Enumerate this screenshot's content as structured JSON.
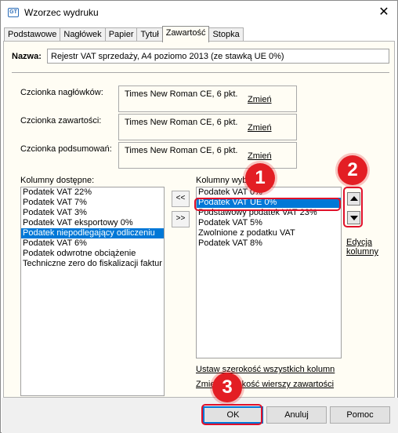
{
  "window": {
    "title": "Wzorzec wydruku",
    "icon": "app-icon",
    "close_label": "✕"
  },
  "tabs": [
    "Podstawowe",
    "Nagłówek",
    "Papier",
    "Tytuł",
    "Zawartość",
    "Stopka"
  ],
  "active_tab": "Zawartość",
  "name": {
    "label": "Nazwa:",
    "value": "Rejestr VAT sprzedaży, A4 poziomo 2013 (ze stawką UE 0%)"
  },
  "fonts": [
    {
      "label": "Czcionka nagłówków:",
      "value": "Times New Roman CE, 6 pkt.",
      "action": "Zmień"
    },
    {
      "label": "Czcionka zawartości:",
      "value": "Times New Roman CE, 6 pkt.",
      "action": "Zmień"
    },
    {
      "label": "Czcionka podsumowań:",
      "value": "Times New Roman CE, 6 pkt.",
      "action": "Zmień"
    }
  ],
  "available": {
    "label": "Kolumny dostępne:",
    "items": [
      "Podatek VAT 22%",
      "Podatek VAT 7%",
      "Podatek VAT 3%",
      "Podatek VAT eksportowy 0%",
      "Podatek niepodlegający odliczeniu",
      "Podatek VAT 6%",
      "Podatek odwrotne obciążenie",
      "Techniczne zero do fiskalizacji faktur r"
    ],
    "selected_index": 4
  },
  "move_buttons": {
    "left": "<<",
    "right": ">>"
  },
  "chosen": {
    "label": "Kolumny wybrane",
    "items": [
      "Podatek VAT 0%",
      "Podatek VAT UE 0%",
      "Podstawowy podatek VAT 23%",
      "Podatek VAT 5%",
      "Zwolnione z podatku VAT",
      "Podatek VAT 8%"
    ],
    "selected_index": 1
  },
  "edit_columns": {
    "line1": "Edycja",
    "line2": "kolumny"
  },
  "links": {
    "set_width": "Ustaw szerokość wszystkich kolumn",
    "change_height": "Zmień wysokość wierszy zawartości"
  },
  "buttons": {
    "ok": "OK",
    "cancel": "Anuluj",
    "help": "Pomoc"
  },
  "badges": [
    "1",
    "2",
    "3"
  ],
  "colors": {
    "highlight": "#e0102a",
    "badge": "#e31e24",
    "selection": "#0078d7",
    "panel": "#fffdf4"
  }
}
